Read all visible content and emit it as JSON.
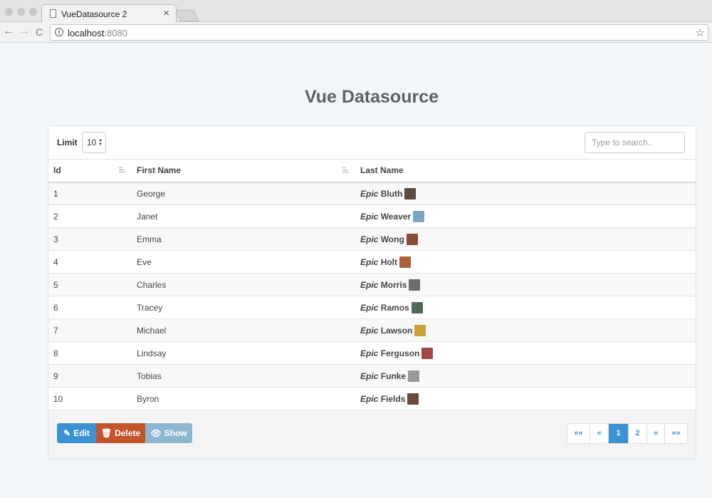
{
  "browser": {
    "tab_title": "VueDatasource 2",
    "tab_close": "×",
    "url_host": "localhost",
    "url_port": ":8080",
    "info_glyph": "i",
    "star_glyph": "☆",
    "back_glyph": "←",
    "forward_glyph": "→",
    "reload_glyph": "C"
  },
  "page": {
    "title": "Vue Datasource"
  },
  "controls": {
    "limit_label": "Limit",
    "limit_value": "10",
    "search_placeholder": "Type to search.."
  },
  "table": {
    "headers": {
      "id": "Id",
      "first_name": "First Name",
      "last_name": "Last Name"
    },
    "epic_prefix": "Epic",
    "rows": [
      {
        "id": "1",
        "first_name": "George",
        "last_name": "Bluth",
        "avatar_color": "#5b4a3f"
      },
      {
        "id": "2",
        "first_name": "Janet",
        "last_name": "Weaver",
        "avatar_color": "#7aa6c2"
      },
      {
        "id": "3",
        "first_name": "Emma",
        "last_name": "Wong",
        "avatar_color": "#8a4a3a"
      },
      {
        "id": "4",
        "first_name": "Eve",
        "last_name": "Holt",
        "avatar_color": "#b0603a"
      },
      {
        "id": "5",
        "first_name": "Charles",
        "last_name": "Morris",
        "avatar_color": "#6e6e6e"
      },
      {
        "id": "6",
        "first_name": "Tracey",
        "last_name": "Ramos",
        "avatar_color": "#4f6a5a"
      },
      {
        "id": "7",
        "first_name": "Michael",
        "last_name": "Lawson",
        "avatar_color": "#c9a23a"
      },
      {
        "id": "8",
        "first_name": "Lindsay",
        "last_name": "Ferguson",
        "avatar_color": "#a04848"
      },
      {
        "id": "9",
        "first_name": "Tobias",
        "last_name": "Funke",
        "avatar_color": "#9a9a9a"
      },
      {
        "id": "10",
        "first_name": "Byron",
        "last_name": "Fields",
        "avatar_color": "#6a4a3a"
      }
    ]
  },
  "actions": {
    "edit_label": "Edit",
    "delete_label": "Delete",
    "show_label": "Show"
  },
  "pagination": {
    "first": "««",
    "prev": "«",
    "pages": [
      "1",
      "2"
    ],
    "current": "1",
    "next": "»",
    "last": "»»"
  },
  "colors": {
    "primary": "#3a92d1",
    "danger": "#c4542c",
    "info_disabled": "#8fb6d1"
  }
}
